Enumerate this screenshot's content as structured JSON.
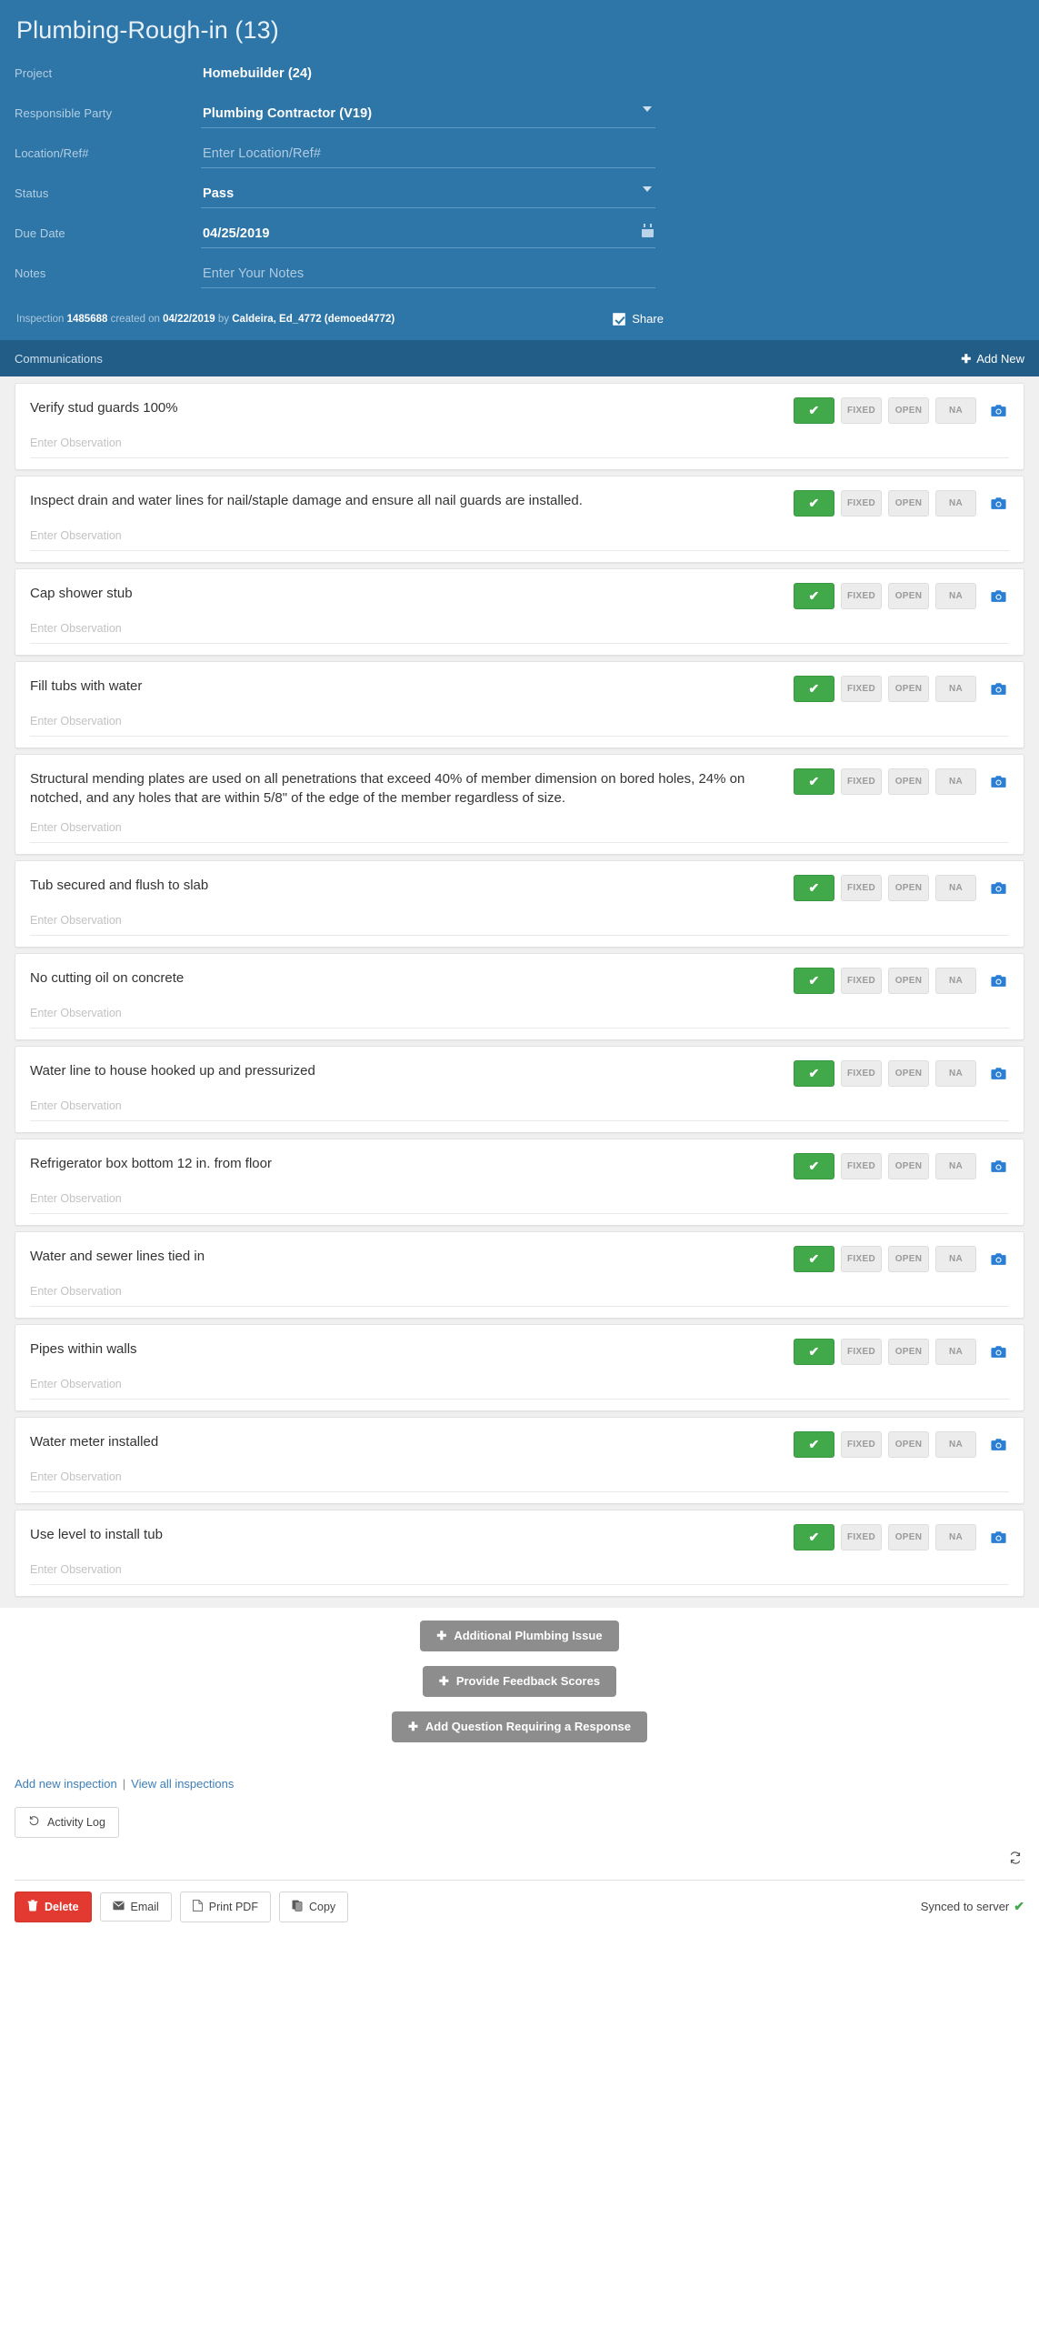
{
  "header": {
    "title": "Plumbing-Rough-in (13)",
    "fields": [
      {
        "label": "Project",
        "value": "Homebuilder (24)",
        "type": "static"
      },
      {
        "label": "Responsible Party",
        "value": "Plumbing Contractor (V19)",
        "type": "select"
      },
      {
        "label": "Location/Ref#",
        "placeholder": "Enter Location/Ref#",
        "type": "text"
      },
      {
        "label": "Status",
        "value": "Pass",
        "type": "select"
      },
      {
        "label": "Due Date",
        "value": "04/25/2019",
        "type": "date"
      },
      {
        "label": "Notes",
        "placeholder": "Enter Your Notes",
        "type": "text"
      }
    ],
    "meta": {
      "prefix": "Inspection ",
      "id": "1485688",
      "created_label": " created on ",
      "created_date": "04/22/2019",
      "by_label": " by ",
      "author": "Caldeira, Ed_4772 (demoed4772)"
    },
    "share_label": "Share",
    "share_checked": true
  },
  "communications": {
    "title": "Communications",
    "add_new_label": "Add New",
    "add_icon": "plus-icon"
  },
  "checklist": {
    "observation_placeholder": "Enter Observation",
    "status_buttons": [
      {
        "key": "pass",
        "label": "✔",
        "name": "pass-button",
        "selected": true
      },
      {
        "key": "fixed",
        "label": "FIXED",
        "name": "fixed-button",
        "selected": false
      },
      {
        "key": "open",
        "label": "OPEN",
        "name": "open-button",
        "selected": false
      },
      {
        "key": "na",
        "label": "NA",
        "name": "na-button",
        "selected": false
      }
    ],
    "camera_icon": "camera-icon",
    "items": [
      {
        "text": "Verify stud guards 100%"
      },
      {
        "text": "Inspect drain and water lines for nail/staple damage and ensure all nail guards are installed."
      },
      {
        "text": "Cap shower stub"
      },
      {
        "text": "Fill tubs with water"
      },
      {
        "text": "Structural mending plates are used on all penetrations that exceed 40% of member dimension on bored holes, 24% on notched, and any holes that are within 5/8\" of the edge of the member regardless of size."
      },
      {
        "text": "Tub secured and flush to slab"
      },
      {
        "text": "No cutting oil on concrete"
      },
      {
        "text": "Water line to house hooked up and pressurized"
      },
      {
        "text": "Refrigerator box bottom 12 in. from floor"
      },
      {
        "text": "Water and sewer lines tied in"
      },
      {
        "text": "Pipes within walls"
      },
      {
        "text": "Water meter installed"
      },
      {
        "text": "Use level to install tub"
      }
    ]
  },
  "actions": [
    {
      "label": "Additional Plumbing Issue",
      "name": "additional-plumbing-issue-button"
    },
    {
      "label": "Provide Feedback Scores",
      "name": "provide-feedback-scores-button"
    },
    {
      "label": "Add Question Requiring a Response",
      "name": "add-question-requiring-response-button"
    }
  ],
  "footer": {
    "add_new_inspection": "Add new inspection",
    "separator": "|",
    "view_all_inspections": "View all inspections",
    "activity_log_label": "Activity Log",
    "activity_log_icon": "history-icon",
    "sync_icon": "refresh-icon",
    "buttons": [
      {
        "label": "Delete",
        "name": "delete-button",
        "icon": "trash-icon"
      },
      {
        "label": "Email",
        "name": "email-button",
        "icon": "envelope-icon"
      },
      {
        "label": "Print PDF",
        "name": "print-pdf-button",
        "icon": "file-icon"
      },
      {
        "label": "Copy",
        "name": "copy-button",
        "icon": "copy-icon"
      }
    ],
    "sync_status": "Synced to server",
    "sync_check": "✔"
  },
  "colors": {
    "header_bg": "#2e75a8",
    "comm_bg": "#215d86",
    "pass_green": "#41a94a",
    "link_blue": "#3c7eb8",
    "danger_red": "#e23a30",
    "camera_blue": "#2a7fd4"
  }
}
